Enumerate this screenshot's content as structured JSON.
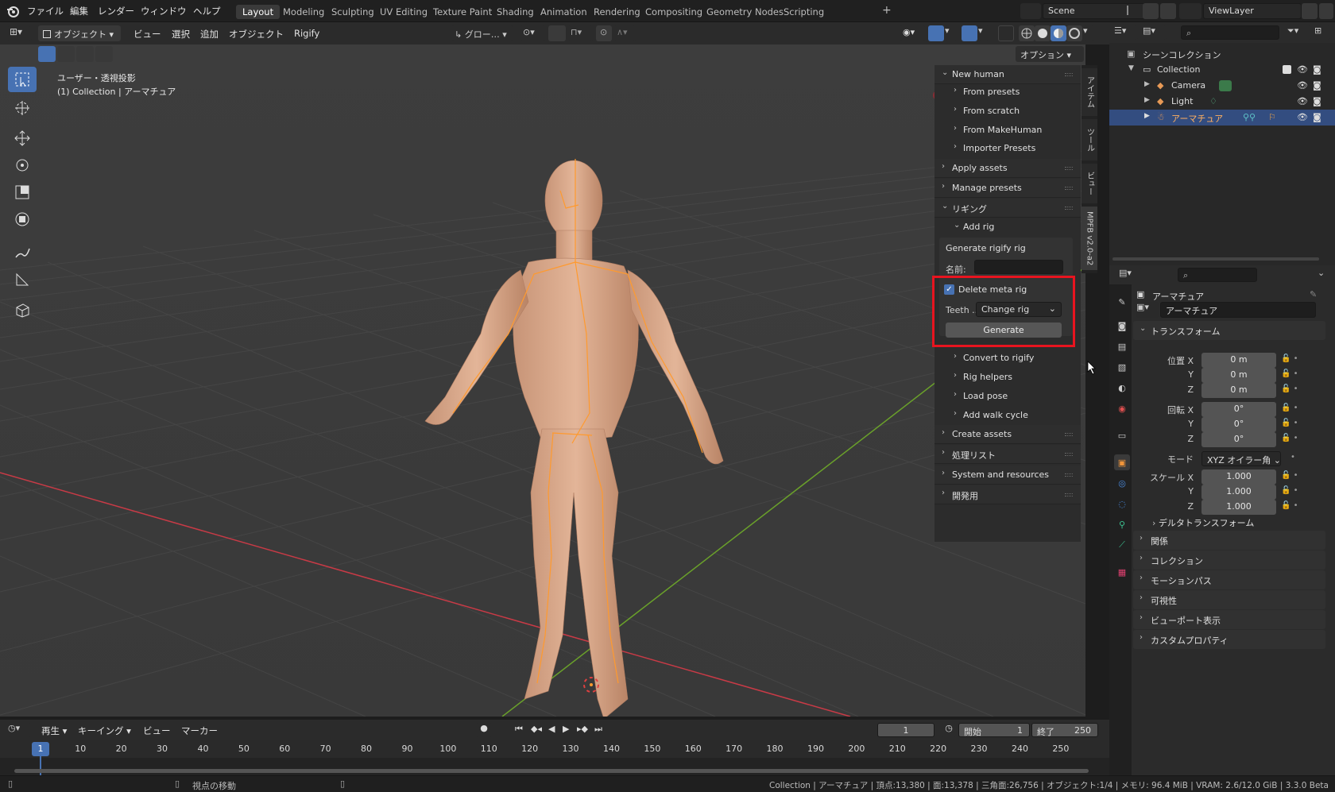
{
  "menu": [
    "ファイル",
    "編集",
    "レンダー",
    "ウィンドウ",
    "ヘルプ"
  ],
  "workspaces": [
    "Layout",
    "Modeling",
    "Sculpting",
    "UV Editing",
    "Texture Paint",
    "Shading",
    "Animation",
    "Rendering",
    "Compositing",
    "Geometry Nodes",
    "Scripting"
  ],
  "scene": "Scene",
  "viewlayer": "ViewLayer",
  "viewport_header": {
    "mode": "オブジェクト",
    "items": [
      "ビュー",
      "選択",
      "追加",
      "オブジェクト",
      "Rigify"
    ],
    "transform_orientation": "グロー…",
    "options": "オプション"
  },
  "viewport_info": {
    "line1": "ユーザー・透視投影",
    "line2": "(1) Collection | アーマチュア"
  },
  "npanel": {
    "new_human": "New human",
    "from_presets": "From presets",
    "from_scratch": "From scratch",
    "from_makehuman": "From MakeHuman",
    "importer_presets": "Importer Presets",
    "apply_assets": "Apply assets",
    "manage_presets": "Manage presets",
    "rigging": "リギング",
    "add_rig": "Add rig",
    "generate_rigify": "Generate rigify rig",
    "name_label": "名前:",
    "name_value": "",
    "delete_meta_rig": "Delete meta rig",
    "delete_meta_rig_checked": true,
    "teeth_label": "Teeth ...",
    "teeth_value": "Change rig",
    "generate": "Generate",
    "convert_to_rigify": "Convert to rigify",
    "rig_helpers": "Rig helpers",
    "load_pose": "Load pose",
    "add_walk_cycle": "Add walk cycle",
    "create_assets": "Create assets",
    "processing_list": "処理リスト",
    "system_resources": "System and resources",
    "development": "開発用",
    "tabs": [
      "アイテム",
      "ツール",
      "ビュー",
      "MPFB v2.0-a2"
    ],
    "highlight_color": "#e8141f"
  },
  "outliner": {
    "root": "シーンコレクション",
    "collection": "Collection",
    "items": [
      "Camera",
      "Light",
      "アーマチュア"
    ]
  },
  "properties": {
    "object_name": "アーマチュア",
    "data_name": "アーマチュア",
    "transform": "トランスフォーム",
    "location_label": "位置 X",
    "rotation_label": "回転 X",
    "scale_label": "スケール X",
    "y": "Y",
    "z": "Z",
    "location": [
      "0 m",
      "0 m",
      "0 m"
    ],
    "rotation": [
      "0°",
      "0°",
      "0°"
    ],
    "mode_label": "モード",
    "mode_value": "XYZ オイラー角",
    "scale": [
      "1.000",
      "1.000",
      "1.000"
    ],
    "delta": "デルタトランスフォーム",
    "sections": [
      "関係",
      "コレクション",
      "モーションパス",
      "可視性",
      "ビューポート表示",
      "カスタムプロパティ"
    ]
  },
  "timeline": {
    "playback": "再生",
    "keying": "キーイング",
    "view": "ビュー",
    "marker": "マーカー",
    "current_frame": "1",
    "start_label": "開始",
    "start": "1",
    "end_label": "終了",
    "end": "250",
    "ticks": [
      "1",
      "10",
      "20",
      "30",
      "40",
      "50",
      "60",
      "70",
      "80",
      "90",
      "100",
      "110",
      "120",
      "130",
      "140",
      "150",
      "160",
      "170",
      "180",
      "190",
      "200",
      "210",
      "220",
      "230",
      "240",
      "250"
    ]
  },
  "status": {
    "left": "視点の移動",
    "right": "Collection | アーマチュア | 頂点:13,380 | 面:13,378 | 三角面:26,756 | オブジェクト:1/4 | メモリ: 96.4 MiB | VRAM: 2.6/12.0 GiB | 3.3.0 Beta"
  },
  "colors": {
    "accent": "#4772b3",
    "armature": "#ff9a2e",
    "x_axis": "#c83a46",
    "y_axis": "#6aa12a",
    "skin": "#d9a98a"
  }
}
